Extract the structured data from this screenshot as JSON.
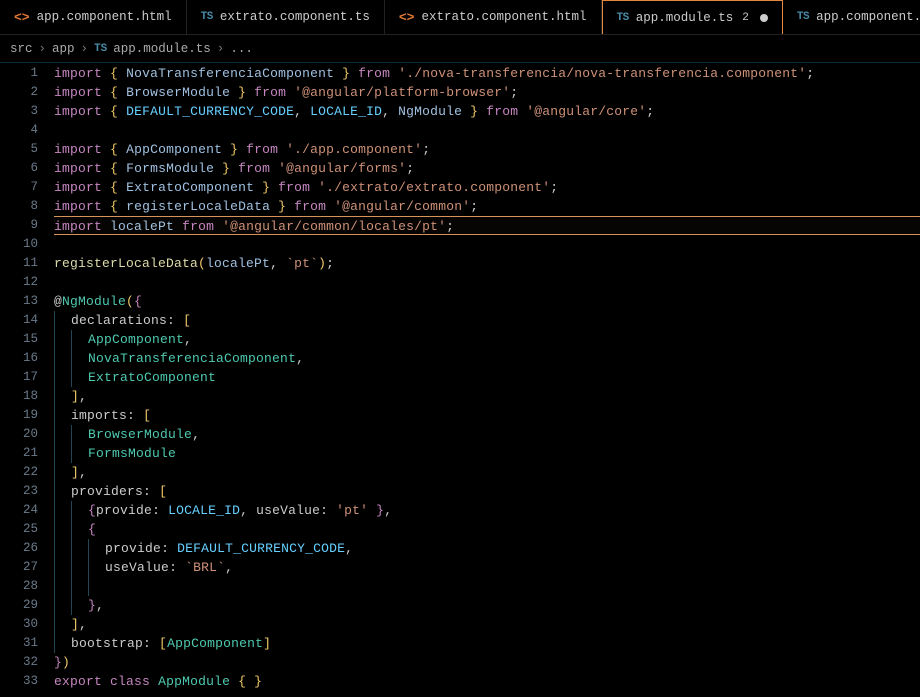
{
  "tabs": [
    {
      "icon": "html",
      "label": "app.component.html",
      "active": false,
      "dirty": false
    },
    {
      "icon": "ts",
      "label": "extrato.component.ts",
      "active": false,
      "dirty": false
    },
    {
      "icon": "html",
      "label": "extrato.component.html",
      "active": false,
      "dirty": false
    },
    {
      "icon": "ts",
      "label": "app.module.ts",
      "active": true,
      "dirty": true,
      "dirtyCount": "2"
    },
    {
      "icon": "ts",
      "label": "app.component.ts",
      "active": false,
      "dirty": false
    }
  ],
  "breadcrumbs": {
    "segments": [
      "src",
      "app"
    ],
    "fileIcon": "ts",
    "file": "app.module.ts",
    "more": "..."
  },
  "code": {
    "lines": [
      {
        "n": 1,
        "t": [
          [
            "kw",
            "import"
          ],
          [
            "pn",
            " "
          ],
          [
            "br",
            "{"
          ],
          [
            "pn",
            " "
          ],
          [
            "id",
            "NovaTransferenciaComponent"
          ],
          [
            "pn",
            " "
          ],
          [
            "br",
            "}"
          ],
          [
            "pn",
            " "
          ],
          [
            "kw",
            "from"
          ],
          [
            "pn",
            " "
          ],
          [
            "str",
            "'./nova-transferencia/nova-transferencia.component'"
          ],
          [
            "pn",
            ";"
          ]
        ]
      },
      {
        "n": 2,
        "t": [
          [
            "kw",
            "import"
          ],
          [
            "pn",
            " "
          ],
          [
            "br",
            "{"
          ],
          [
            "pn",
            " "
          ],
          [
            "id",
            "BrowserModule"
          ],
          [
            "pn",
            " "
          ],
          [
            "br",
            "}"
          ],
          [
            "pn",
            " "
          ],
          [
            "kw",
            "from"
          ],
          [
            "pn",
            " "
          ],
          [
            "str",
            "'@angular/platform-browser'"
          ],
          [
            "pn",
            ";"
          ]
        ]
      },
      {
        "n": 3,
        "t": [
          [
            "kw",
            "import"
          ],
          [
            "pn",
            " "
          ],
          [
            "br",
            "{"
          ],
          [
            "pn",
            " "
          ],
          [
            "const",
            "DEFAULT_CURRENCY_CODE"
          ],
          [
            "pn",
            ", "
          ],
          [
            "const",
            "LOCALE_ID"
          ],
          [
            "pn",
            ", "
          ],
          [
            "id",
            "NgModule"
          ],
          [
            "pn",
            " "
          ],
          [
            "br",
            "}"
          ],
          [
            "pn",
            " "
          ],
          [
            "kw",
            "from"
          ],
          [
            "pn",
            " "
          ],
          [
            "str",
            "'@angular/core'"
          ],
          [
            "pn",
            ";"
          ]
        ]
      },
      {
        "n": 4,
        "t": []
      },
      {
        "n": 5,
        "t": [
          [
            "kw",
            "import"
          ],
          [
            "pn",
            " "
          ],
          [
            "br",
            "{"
          ],
          [
            "pn",
            " "
          ],
          [
            "id",
            "AppComponent"
          ],
          [
            "pn",
            " "
          ],
          [
            "br",
            "}"
          ],
          [
            "pn",
            " "
          ],
          [
            "kw",
            "from"
          ],
          [
            "pn",
            " "
          ],
          [
            "str",
            "'./app.component'"
          ],
          [
            "pn",
            ";"
          ]
        ]
      },
      {
        "n": 6,
        "t": [
          [
            "kw",
            "import"
          ],
          [
            "pn",
            " "
          ],
          [
            "br",
            "{"
          ],
          [
            "pn",
            " "
          ],
          [
            "id",
            "FormsModule"
          ],
          [
            "pn",
            " "
          ],
          [
            "br",
            "}"
          ],
          [
            "pn",
            " "
          ],
          [
            "kw",
            "from"
          ],
          [
            "pn",
            " "
          ],
          [
            "str",
            "'@angular/forms'"
          ],
          [
            "pn",
            ";"
          ]
        ]
      },
      {
        "n": 7,
        "t": [
          [
            "kw",
            "import"
          ],
          [
            "pn",
            " "
          ],
          [
            "br",
            "{"
          ],
          [
            "pn",
            " "
          ],
          [
            "id",
            "ExtratoComponent"
          ],
          [
            "pn",
            " "
          ],
          [
            "br",
            "}"
          ],
          [
            "pn",
            " "
          ],
          [
            "kw",
            "from"
          ],
          [
            "pn",
            " "
          ],
          [
            "str",
            "'./extrato/extrato.component'"
          ],
          [
            "pn",
            ";"
          ]
        ]
      },
      {
        "n": 8,
        "t": [
          [
            "kw",
            "import"
          ],
          [
            "pn",
            " "
          ],
          [
            "br",
            "{"
          ],
          [
            "pn",
            " "
          ],
          [
            "id",
            "registerLocaleData"
          ],
          [
            "pn",
            " "
          ],
          [
            "br",
            "}"
          ],
          [
            "pn",
            " "
          ],
          [
            "kw",
            "from"
          ],
          [
            "pn",
            " "
          ],
          [
            "str",
            "'@angular/common'"
          ],
          [
            "pn",
            ";"
          ]
        ]
      },
      {
        "n": 9,
        "hl": true,
        "t": [
          [
            "kw",
            "import"
          ],
          [
            "pn",
            " "
          ],
          [
            "id",
            "localePt"
          ],
          [
            "pn",
            " "
          ],
          [
            "kw",
            "from"
          ],
          [
            "pn",
            " "
          ],
          [
            "str",
            "'@angular/common/locales/pt'"
          ],
          [
            "pn",
            ";"
          ]
        ]
      },
      {
        "n": 10,
        "t": []
      },
      {
        "n": 11,
        "t": [
          [
            "fn",
            "registerLocaleData"
          ],
          [
            "br",
            "("
          ],
          [
            "id",
            "localePt"
          ],
          [
            "pn",
            ", "
          ],
          [
            "str",
            "`pt`"
          ],
          [
            "br",
            ")"
          ],
          [
            "pn",
            ";"
          ]
        ]
      },
      {
        "n": 12,
        "t": []
      },
      {
        "n": 13,
        "t": [
          [
            "pn",
            "@"
          ],
          [
            "deco",
            "NgModule"
          ],
          [
            "br",
            "("
          ],
          [
            "br2",
            "{"
          ]
        ]
      },
      {
        "n": 14,
        "indent": 1,
        "t": [
          [
            "prop",
            "declarations"
          ],
          [
            "pn",
            ":"
          ],
          [
            "pn",
            " "
          ],
          [
            "br",
            "["
          ]
        ]
      },
      {
        "n": 15,
        "indent": 2,
        "t": [
          [
            "class",
            "AppComponent"
          ],
          [
            "pn",
            ","
          ]
        ]
      },
      {
        "n": 16,
        "indent": 2,
        "t": [
          [
            "class",
            "NovaTransferenciaComponent"
          ],
          [
            "pn",
            ","
          ]
        ]
      },
      {
        "n": 17,
        "indent": 2,
        "t": [
          [
            "class",
            "ExtratoComponent"
          ]
        ]
      },
      {
        "n": 18,
        "indent": 1,
        "t": [
          [
            "br",
            "]"
          ],
          [
            "pn",
            ","
          ]
        ]
      },
      {
        "n": 19,
        "indent": 1,
        "t": [
          [
            "prop",
            "imports"
          ],
          [
            "pn",
            ":"
          ],
          [
            "pn",
            " "
          ],
          [
            "br",
            "["
          ]
        ]
      },
      {
        "n": 20,
        "indent": 2,
        "t": [
          [
            "class",
            "BrowserModule"
          ],
          [
            "pn",
            ","
          ]
        ]
      },
      {
        "n": 21,
        "indent": 2,
        "t": [
          [
            "class",
            "FormsModule"
          ]
        ]
      },
      {
        "n": 22,
        "indent": 1,
        "t": [
          [
            "br",
            "]"
          ],
          [
            "pn",
            ","
          ]
        ]
      },
      {
        "n": 23,
        "indent": 1,
        "t": [
          [
            "prop",
            "providers"
          ],
          [
            "pn",
            ":"
          ],
          [
            "pn",
            " "
          ],
          [
            "br",
            "["
          ]
        ]
      },
      {
        "n": 24,
        "indent": 2,
        "t": [
          [
            "br2",
            "{"
          ],
          [
            "prop",
            "provide"
          ],
          [
            "pn",
            ": "
          ],
          [
            "const",
            "LOCALE_ID"
          ],
          [
            "pn",
            ", "
          ],
          [
            "prop",
            "useValue"
          ],
          [
            "pn",
            ": "
          ],
          [
            "str",
            "'pt'"
          ],
          [
            "pn",
            " "
          ],
          [
            "br2",
            "}"
          ],
          [
            "pn",
            ","
          ]
        ]
      },
      {
        "n": 25,
        "indent": 2,
        "t": [
          [
            "br2",
            "{"
          ]
        ]
      },
      {
        "n": 26,
        "indent": 3,
        "t": [
          [
            "prop",
            "provide"
          ],
          [
            "pn",
            ": "
          ],
          [
            "const",
            "DEFAULT_CURRENCY_CODE"
          ],
          [
            "pn",
            ","
          ]
        ]
      },
      {
        "n": 27,
        "indent": 3,
        "t": [
          [
            "prop",
            "useValue"
          ],
          [
            "pn",
            ": "
          ],
          [
            "str",
            "`BRL`"
          ],
          [
            "pn",
            ","
          ]
        ]
      },
      {
        "n": 28,
        "indent": 3,
        "t": []
      },
      {
        "n": 29,
        "indent": 2,
        "t": [
          [
            "br2",
            "}"
          ],
          [
            "pn",
            ","
          ]
        ]
      },
      {
        "n": 30,
        "indent": 1,
        "t": [
          [
            "br",
            "]"
          ],
          [
            "pn",
            ","
          ]
        ]
      },
      {
        "n": 31,
        "indent": 1,
        "t": [
          [
            "prop",
            "bootstrap"
          ],
          [
            "pn",
            ": "
          ],
          [
            "br",
            "["
          ],
          [
            "class",
            "AppComponent"
          ],
          [
            "br",
            "]"
          ]
        ]
      },
      {
        "n": 32,
        "t": [
          [
            "br2",
            "}"
          ],
          [
            "br",
            ")"
          ]
        ]
      },
      {
        "n": 33,
        "t": [
          [
            "kw",
            "export"
          ],
          [
            "pn",
            " "
          ],
          [
            "kw",
            "class"
          ],
          [
            "pn",
            " "
          ],
          [
            "class",
            "AppModule"
          ],
          [
            "pn",
            " "
          ],
          [
            "br",
            "{"
          ],
          [
            "pn",
            " "
          ],
          [
            "br",
            "}"
          ]
        ]
      }
    ]
  }
}
